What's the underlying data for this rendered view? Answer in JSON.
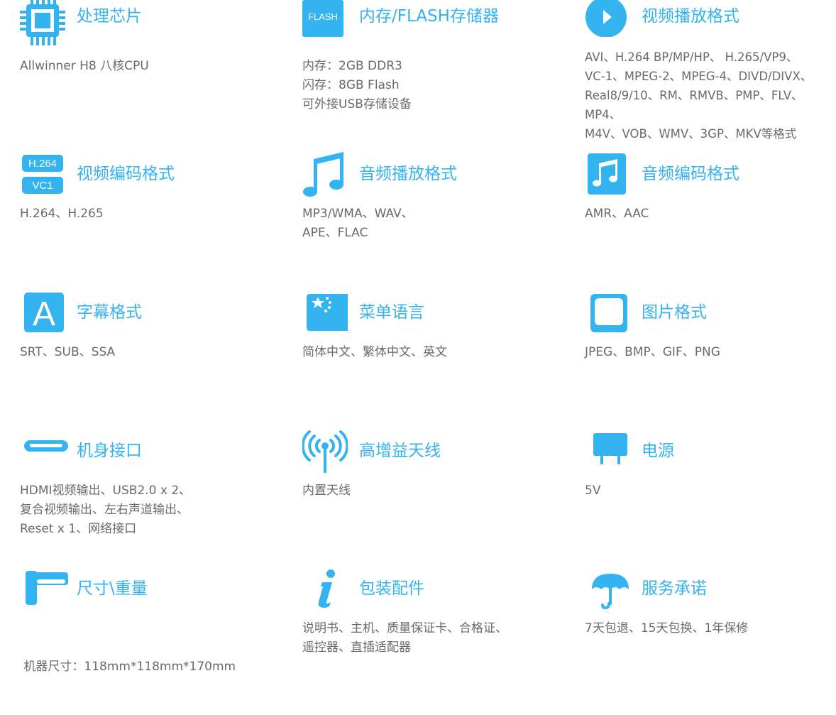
{
  "accent_color": "#33b3f0",
  "text_color": "#6a6a6a",
  "items": [
    {
      "icon": "cpu-chip-icon",
      "title": "处理芯片",
      "lines": [
        "Allwinner H8 八核CPU"
      ]
    },
    {
      "icon": "flash-memory-icon",
      "icon_text": "FLASH",
      "title": "内存/FLASH存储器",
      "lines": [
        "内存：2GB DDR3",
        "闪存：8GB Flash",
        "可外接USB存储设备"
      ]
    },
    {
      "icon": "play-circle-icon",
      "title": "视频播放格式",
      "lines": [
        "AVI、H.264 BP/MP/HP、 H.265/VP9、",
        "VC-1、MPEG-2、MPEG-4、DIVD/DIVX、",
        "Real8/9/10、RM、RMVB、PMP、FLV、",
        "MP4、",
        "M4V、VOB、WMV、3GP、MKV等格式"
      ]
    },
    {
      "icon": "codec-badge-icon",
      "icon_text_1": "H.264",
      "icon_text_2": "VC1",
      "title": "视频编码格式",
      "lines": [
        "H.264、H.265"
      ]
    },
    {
      "icon": "music-note-icon",
      "title": "音频播放格式",
      "lines": [
        "MP3/WMA、WAV、",
        "APE、FLAC"
      ]
    },
    {
      "icon": "music-note-square-icon",
      "title": "音频编码格式",
      "lines": [
        "AMR、AAC"
      ]
    },
    {
      "icon": "subtitle-letter-icon",
      "icon_text": "A",
      "title": "字幕格式",
      "lines": [
        "SRT、SUB、SSA"
      ]
    },
    {
      "icon": "flag-language-icon",
      "title": "菜单语言",
      "lines": [
        "简体中文、繁体中文、英文"
      ]
    },
    {
      "icon": "picture-frame-icon",
      "title": "图片格式",
      "lines": [
        "JPEG、BMP、GIF、PNG"
      ]
    },
    {
      "icon": "hdmi-port-icon",
      "title": "机身接口",
      "lines": [
        "HDMI视频输出、USB2.0 x 2、",
        "复合视频输出、左右声道输出、",
        "Reset x 1、网络接口"
      ]
    },
    {
      "icon": "antenna-signal-icon",
      "title": "高增益天线",
      "lines": [
        "内置天线"
      ]
    },
    {
      "icon": "power-plug-icon",
      "title": "电源",
      "lines": [
        "5V"
      ]
    },
    {
      "icon": "dimension-bracket-icon",
      "title": "尺寸\\重量",
      "lines": [
        " 机器尺寸：118mm*118mm*170mm"
      ]
    },
    {
      "icon": "info-icon",
      "title": "包装配件",
      "lines": [
        "说明书、主机、质量保证卡、合格证、",
        "遥控器、直插适配器"
      ]
    },
    {
      "icon": "umbrella-icon",
      "title": "服务承诺",
      "lines": [
        "7天包退、15天包换、1年保修"
      ]
    }
  ]
}
